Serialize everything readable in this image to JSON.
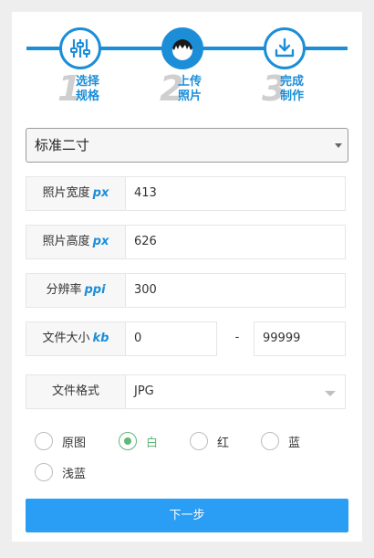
{
  "steps": [
    {
      "num": "1",
      "line1": "选择",
      "line2": "规格",
      "icon": "sliders-icon",
      "active": false
    },
    {
      "num": "2",
      "line1": "上传",
      "line2": "照片",
      "icon": "person-head-icon",
      "active": true
    },
    {
      "num": "3",
      "line1": "完成",
      "line2": "制作",
      "icon": "download-icon",
      "active": false
    }
  ],
  "spec_select": {
    "value": "标准二寸"
  },
  "fields": {
    "width": {
      "label": "照片宽度",
      "unit": "px",
      "value": "413"
    },
    "height": {
      "label": "照片高度",
      "unit": "px",
      "value": "626"
    },
    "resolution": {
      "label": "分辨率",
      "unit": "ppi",
      "value": "300"
    },
    "filesize": {
      "label": "文件大小",
      "unit": "kb",
      "min": "0",
      "separator": "-",
      "max": "99999"
    },
    "format": {
      "label": "文件格式",
      "value": "JPG"
    }
  },
  "background": {
    "options": [
      "原图",
      "白",
      "红",
      "蓝",
      "浅蓝"
    ],
    "selected": "白"
  },
  "next_button": {
    "label": "下一步"
  },
  "colors": {
    "accent": "#1c8ed8",
    "button": "#2a9df5",
    "checked": "#5fb878"
  }
}
